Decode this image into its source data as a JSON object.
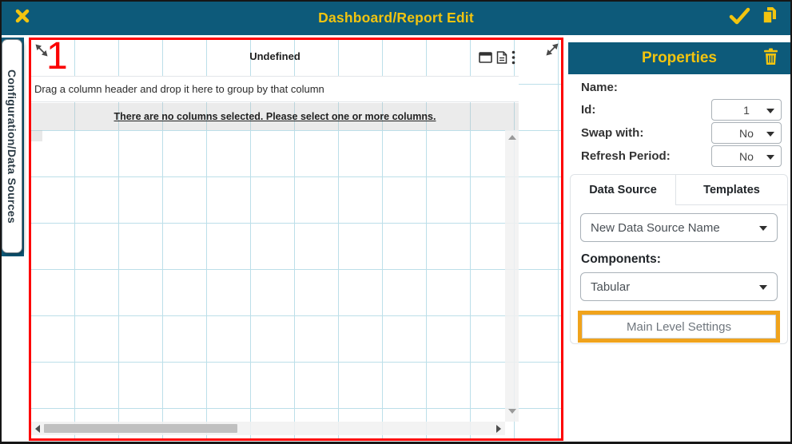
{
  "topbar": {
    "title": "Dashboard/Report Edit"
  },
  "left_tab": {
    "label": "Configuration/Data Sources"
  },
  "canvas": {
    "widget_id": "1",
    "widget_title": "Undefined",
    "group_hint": "Drag a column header and drop it here to group by that column",
    "no_columns_message": "There are no columns selected. Please select one or more columns."
  },
  "properties": {
    "title": "Properties",
    "name_label": "Name:",
    "id_label": "Id:",
    "id_value": "1",
    "swap_label": "Swap with:",
    "swap_value": "No",
    "refresh_label": "Refresh Period:",
    "refresh_value": "No",
    "tabs": [
      {
        "label": "Data Source",
        "active": true
      },
      {
        "label": "Templates",
        "active": false
      }
    ],
    "data_source_value": "New Data Source Name",
    "components_label": "Components:",
    "components_value": "Tabular",
    "main_level_settings_label": "Main Level Settings"
  },
  "icons": [
    "close-icon",
    "confirm-check-icon",
    "copy-icon",
    "resize-nw-icon",
    "resize-ne-icon",
    "window-icon",
    "document-icon",
    "kebab-menu-icon",
    "trash-icon",
    "chevron-down-icon",
    "scroll-up-icon",
    "scroll-down-icon",
    "scroll-left-icon",
    "scroll-right-icon"
  ],
  "colors": {
    "teal": "#0d5a7a",
    "yellow": "#f2c40f",
    "red_border": "#fd0000",
    "grid_blue": "#bcdfe9",
    "highlight_orange": "#f0a31c"
  }
}
